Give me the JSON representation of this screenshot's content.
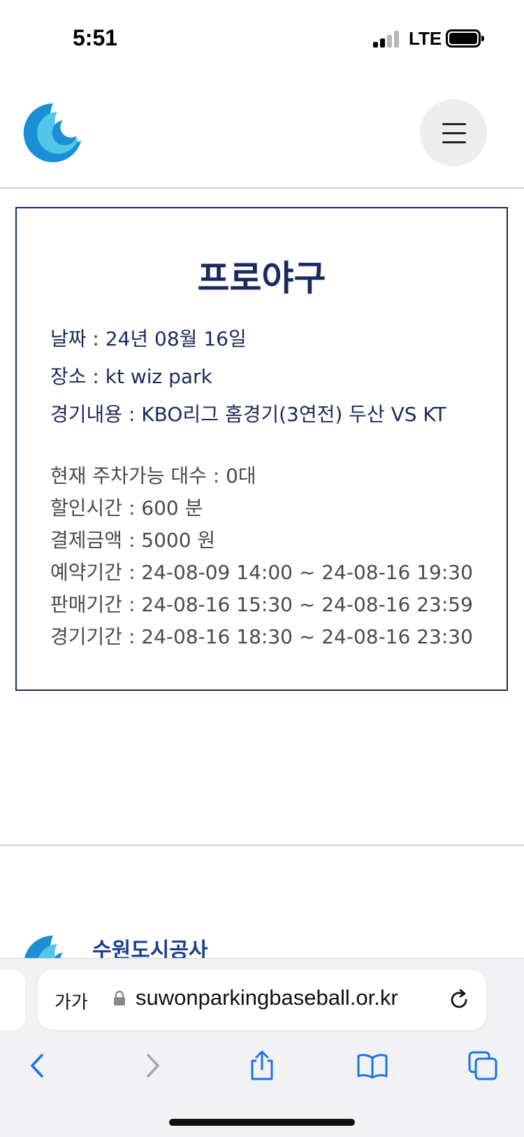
{
  "status": {
    "time": "5:51",
    "network": "LTE"
  },
  "header": {
    "logo": "ring-logo",
    "menu_icon": "hamburger-icon"
  },
  "event": {
    "title": "프로야구",
    "date": "날짜 : 24년 08월 16일",
    "place": "장소 : kt wiz park",
    "content": "경기내용 : KBO리그 홈경기(3연전) 두산 VS KT",
    "available": "현재 주차가능 대수 : 0대",
    "discount_time": "할인시간 : 600 분",
    "payment": "결제금액 : 5000 원",
    "reservation_period": "예약기간 : 24-08-09 14:00 ~ 24-08-16 19:30",
    "sale_period": "판매기간 : 24-08-16 15:30 ~ 24-08-16 23:59",
    "game_period": "경기기간 : 24-08-16 18:30 ~ 24-08-16 23:30"
  },
  "footer": {
    "org_name": "수원도시공사"
  },
  "browser": {
    "text_size_label": "가가",
    "url": "suwonparkingbaseball.or.kr"
  },
  "colors": {
    "accent": "#1b2a5c",
    "logo_blue": "#1a8fd6",
    "logo_cyan": "#52c6e8",
    "ios_blue": "#1a73e8"
  }
}
